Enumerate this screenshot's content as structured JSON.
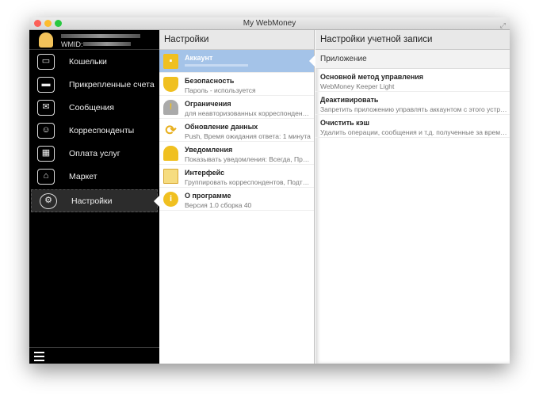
{
  "window": {
    "title": "My WebMoney"
  },
  "sidebar": {
    "wmid_label": "WMID:",
    "items": [
      {
        "label": "Кошельки",
        "icon": "wallet-icon"
      },
      {
        "label": "Прикрепленные счета",
        "icon": "card-icon"
      },
      {
        "label": "Сообщения",
        "icon": "envelope-icon"
      },
      {
        "label": "Корреспонденты",
        "icon": "contacts-icon"
      },
      {
        "label": "Оплата услуг",
        "icon": "services-icon"
      },
      {
        "label": "Маркет",
        "icon": "market-icon"
      },
      {
        "label": "Настройки",
        "icon": "gear-icon",
        "selected": true
      }
    ]
  },
  "middle": {
    "title": "Настройки",
    "items": [
      {
        "title": "Аккаунт",
        "subtitle": "",
        "selected": true
      },
      {
        "title": "Безопасность",
        "subtitle": "Пароль - используется"
      },
      {
        "title": "Ограничения",
        "subtitle": "для неавторизованных корреспондентов"
      },
      {
        "title": "Обновление данных",
        "subtitle": "Push, Время ожидания ответа: 1 минута"
      },
      {
        "title": "Уведомления",
        "subtitle": "Показывать уведомления: Всегда, Прогр..."
      },
      {
        "title": "Интерфейс",
        "subtitle": "Группировать корреспондентов, Подтвер..."
      },
      {
        "title": "О программе",
        "subtitle": "Версия 1.0 сборка 40"
      }
    ]
  },
  "right": {
    "title": "Настройки учетной записи",
    "section": "Приложение",
    "items": [
      {
        "title": "Основной метод управления",
        "subtitle": "WebMoney Keeper Light"
      },
      {
        "title": "Деактивировать",
        "subtitle": "Запретить приложению управлять аккаунтом с этого устройства"
      },
      {
        "title": "Очистить кэш",
        "subtitle": "Удалить операции, сообщения и т.д. полученные за время ра..."
      }
    ]
  },
  "colors": {
    "selected_row": "#a4c3e8",
    "sidebar_bg": "#000000",
    "icon_accent": "#f0c020"
  }
}
